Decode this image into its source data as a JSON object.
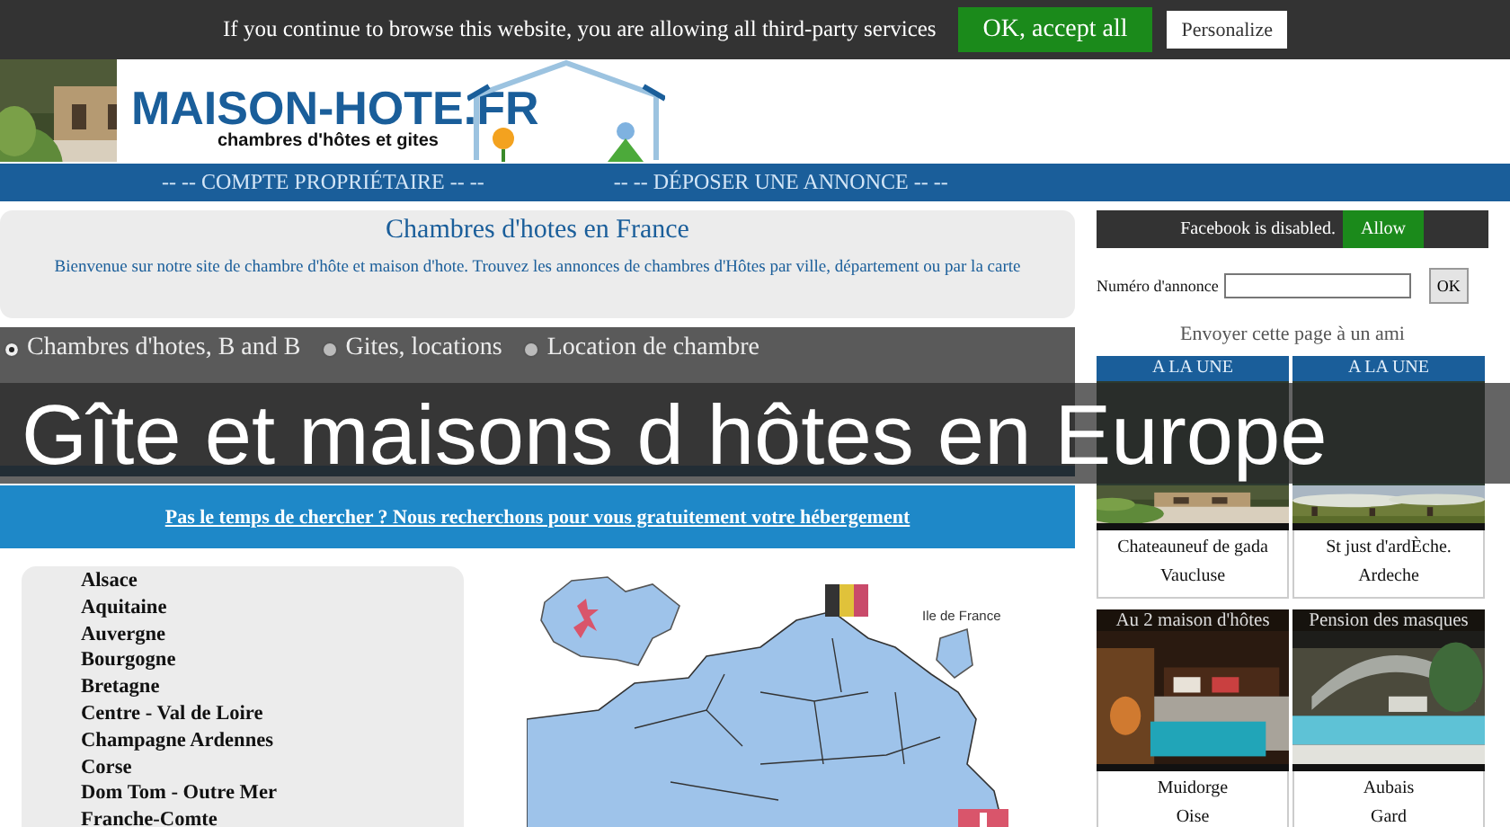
{
  "cookie_bar": {
    "message": "If you continue to browse this website, you are allowing all third-party services",
    "buttons": [
      {
        "label": "OK, accept all",
        "kind": "accept"
      },
      {
        "label": "Personalize",
        "kind": "plain"
      }
    ]
  },
  "header": {
    "logo": "MAISON-HOTE.FR",
    "tagline": "chambres d'hôtes et gites"
  },
  "nav": [
    "-- -- COMPTE PROPRIÉTAIRE -- --",
    "-- -- DÉPOSER UNE ANNONCE -- --"
  ],
  "intro": {
    "title": "Chambres d'hotes en France",
    "text": "Bienvenue sur notre site de chambre d'hôte et maison d'hote. Trouvez les annonces de chambres d'Hôtes par ville, département ou par la carte"
  },
  "search": {
    "options": [
      {
        "label": "Chambres d'hotes, B and B",
        "selected": true
      },
      {
        "label": "Gites, locations",
        "selected": false
      },
      {
        "label": "Location de chambre",
        "selected": false
      }
    ]
  },
  "banner_link": "Pas le temps de chercher ? Nous recherchons pour vous gratuitement votre hébergement",
  "regions": [
    "Alsace",
    "Aquitaine",
    "Auvergne",
    "Bourgogne",
    "Bretagne",
    "Centre - Val de Loire",
    "Champagne Ardennes",
    "Corse",
    "Dom Tom - Outre Mer",
    "Franche-Comte"
  ],
  "map": {
    "label": "Ile de France"
  },
  "overlay_caption": "Gîte et maisons d hôtes en Europe",
  "sidebar": {
    "facebook": {
      "message": "Facebook is disabled.",
      "button": "Allow"
    },
    "ad_number": {
      "label": "Numéro d'annonce",
      "button": "OK"
    },
    "share_link": "Envoyer cette page à un ami",
    "listings": [
      {
        "badge": "A LA UNE",
        "city": "Chateauneuf de gada",
        "department": "Vaucluse"
      },
      {
        "badge": "A LA UNE",
        "city": "St just d'ardÈche.",
        "department": "Ardeche"
      },
      {
        "title": "Au 2 maison d'hôtes",
        "city": "Muidorge",
        "department": "Oise"
      },
      {
        "title": "Pension des masques",
        "city": "Aubais",
        "department": "Gard"
      }
    ]
  }
}
